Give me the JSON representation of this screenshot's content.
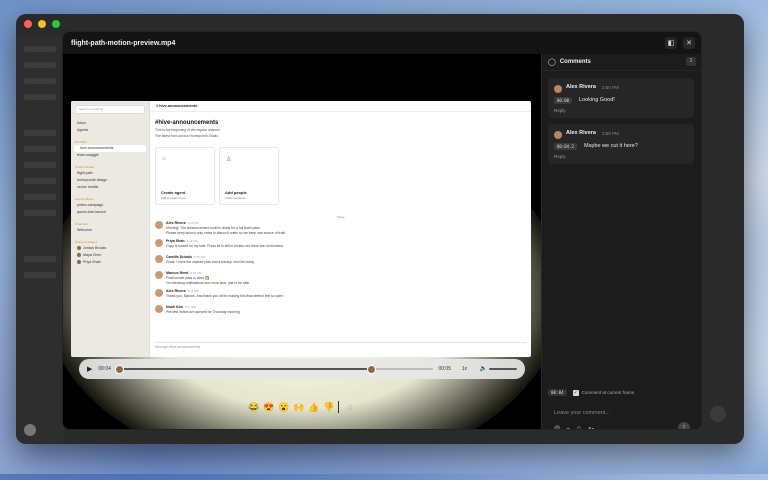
{
  "modal": {
    "title": "flight-path-motion-preview.mp4"
  },
  "video": {
    "sidebar": {
      "search_placeholder": "Search everything",
      "top_items": [
        "Inbox",
        "Agents"
      ],
      "sections": [
        {
          "title": "For Marc",
          "items": [
            "hive-announcements",
            "team-snaggle"
          ]
        },
        {
          "title": "Product Board",
          "items": [
            "flight path",
            "honeycomb design",
            "vector mobile"
          ]
        },
        {
          "title": "Launch Board",
          "items": [
            "pollen-campaign",
            "queen-bee-launch"
          ]
        },
        {
          "title": "Channels",
          "items": [
            "Welcome"
          ]
        },
        {
          "title": "Direct messages",
          "items": [
            "Jordan Brooks",
            "Maya Chen",
            "Priya Shah"
          ]
        }
      ]
    },
    "channel_top": "# hive-announcements",
    "channel_heading": "#hive-announcements",
    "channel_sub1": "This is the beginning of the regular channel",
    "channel_sub2": "The latest from across Honeycomb Studio",
    "cards": [
      {
        "title": "Create agent",
        "desc": "Add an agent here"
      },
      {
        "title": "Add people",
        "desc": "Invite members"
      }
    ],
    "today": "Today",
    "messages": [
      {
        "name": "Alex Rivera",
        "time": "9:10 AM",
        "text": "Morning! The announcement build is ready for a full team pass."
      },
      {
        "name": "",
        "time": "",
        "text": "Please keep launch-only notes in #launch-notes so we keep one source of truth."
      },
      {
        "name": "Priya Shah",
        "time": "9:12 AM",
        "text": "Copy is locked on my side. Press kit is still in review, but there are no blockers."
      },
      {
        "name": "Camille Dubois",
        "time": "9:15 AM",
        "text": "Great. I have the capture plan and a backup shot list ready."
      },
      {
        "name": "Marcus Reed",
        "time": "9:18 AM",
        "text": "Final smoke pass is clear ✅"
      },
      {
        "name": "",
        "time": "",
        "text": "I'm checking notifications one more time, just to be safe."
      },
      {
        "name": "Alex Rivera",
        "time": "9:21 AM",
        "text": "Thank you, Marcus. And thank you all for making this final stretch feel so calm."
      },
      {
        "name": "Noah Kim",
        "time": "9:27 AM",
        "text": "Preview invites are queued for Thursday morning"
      }
    ],
    "composer_placeholder": "Message #hive-announcements",
    "controls": {
      "current": "00:04",
      "duration": "00:05",
      "speed": "1x",
      "progress": 0.8
    }
  },
  "reactions": [
    "😂",
    "😍",
    "😮",
    "🙌",
    "👍",
    "👎"
  ],
  "comments": {
    "title": "Comments",
    "count": "2",
    "items": [
      {
        "name": "Alex Rivera",
        "time": "3:50 PM",
        "timestamp": "00:00",
        "text": "Looking Good!",
        "reply": "Reply"
      },
      {
        "name": "Alex Rivera",
        "time": "3:50 PM",
        "timestamp": "00:04.2",
        "text": "Maybe we cut it here?",
        "reply": "Reply"
      }
    ],
    "frame_timestamp": "00:04",
    "frame_label": "Comment at current frame",
    "input_placeholder": "Leave your comment..."
  },
  "colors": {
    "traffic_red": "#ff5f57",
    "traffic_yellow": "#febc2e",
    "traffic_green": "#28c840"
  }
}
